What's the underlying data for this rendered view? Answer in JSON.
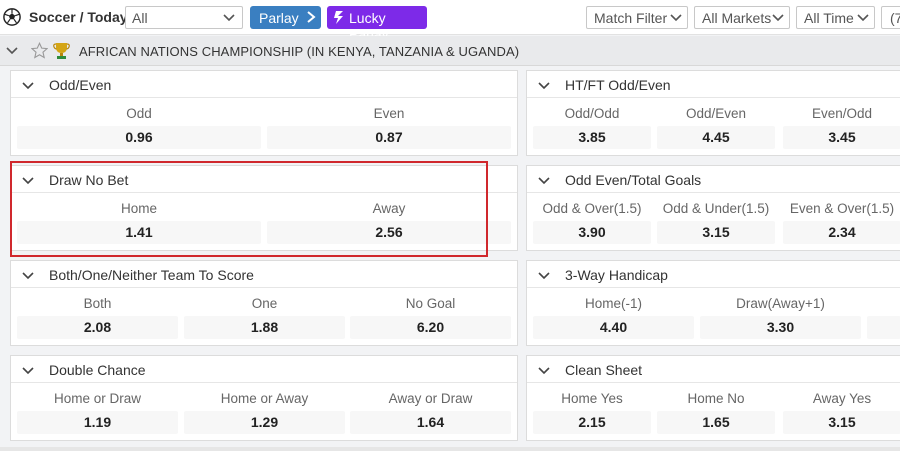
{
  "header": {
    "sport_title": "Soccer / Today",
    "league_select": "All",
    "parlay_label": "Parlay",
    "lucky_parlay_label": "Lucky Parlay",
    "filters": {
      "match_filter": "Match Filter",
      "all_markets": "All Markets",
      "all_time": "All Time",
      "extra": "(7"
    }
  },
  "league": {
    "name": "AFRICAN NATIONS CHAMPIONSHIP (IN KENYA, TANZANIA & UGANDA)"
  },
  "markets": {
    "odd_even": {
      "title": "Odd/Even",
      "labels": [
        "Odd",
        "Even"
      ],
      "odds": [
        "0.96",
        "0.87"
      ]
    },
    "htft_odd_even": {
      "title": "HT/FT Odd/Even",
      "labels": [
        "Odd/Odd",
        "Odd/Even",
        "Even/Odd"
      ],
      "odds": [
        "3.85",
        "4.45",
        "3.45"
      ]
    },
    "draw_no_bet": {
      "title": "Draw No Bet",
      "labels": [
        "Home",
        "Away"
      ],
      "odds": [
        "1.41",
        "2.56"
      ]
    },
    "odd_even_total": {
      "title": "Odd Even/Total Goals",
      "labels": [
        "Odd & Over(1.5)",
        "Odd & Under(1.5)",
        "Even & Over(1.5)"
      ],
      "odds": [
        "3.90",
        "3.15",
        "2.34"
      ]
    },
    "both_one_neither": {
      "title": "Both/One/Neither Team To Score",
      "labels": [
        "Both",
        "One",
        "No Goal"
      ],
      "odds": [
        "2.08",
        "1.88",
        "6.20"
      ]
    },
    "three_way_handicap": {
      "title": "3-Way Handicap",
      "labels": [
        "Home(-1)",
        "Draw(Away+1)"
      ],
      "odds": [
        "4.40",
        "3.30"
      ]
    },
    "double_chance": {
      "title": "Double Chance",
      "labels": [
        "Home or Draw",
        "Home or Away",
        "Away or Draw"
      ],
      "odds": [
        "1.19",
        "1.29",
        "1.64"
      ]
    },
    "clean_sheet": {
      "title": "Clean Sheet",
      "labels": [
        "Home Yes",
        "Home No",
        "Away Yes"
      ],
      "odds": [
        "2.15",
        "1.65",
        "3.15"
      ]
    }
  },
  "colors": {
    "parlay": "#3a7fc1",
    "lucky_parlay": "#7d2ae8",
    "highlight": "#d0282d"
  }
}
